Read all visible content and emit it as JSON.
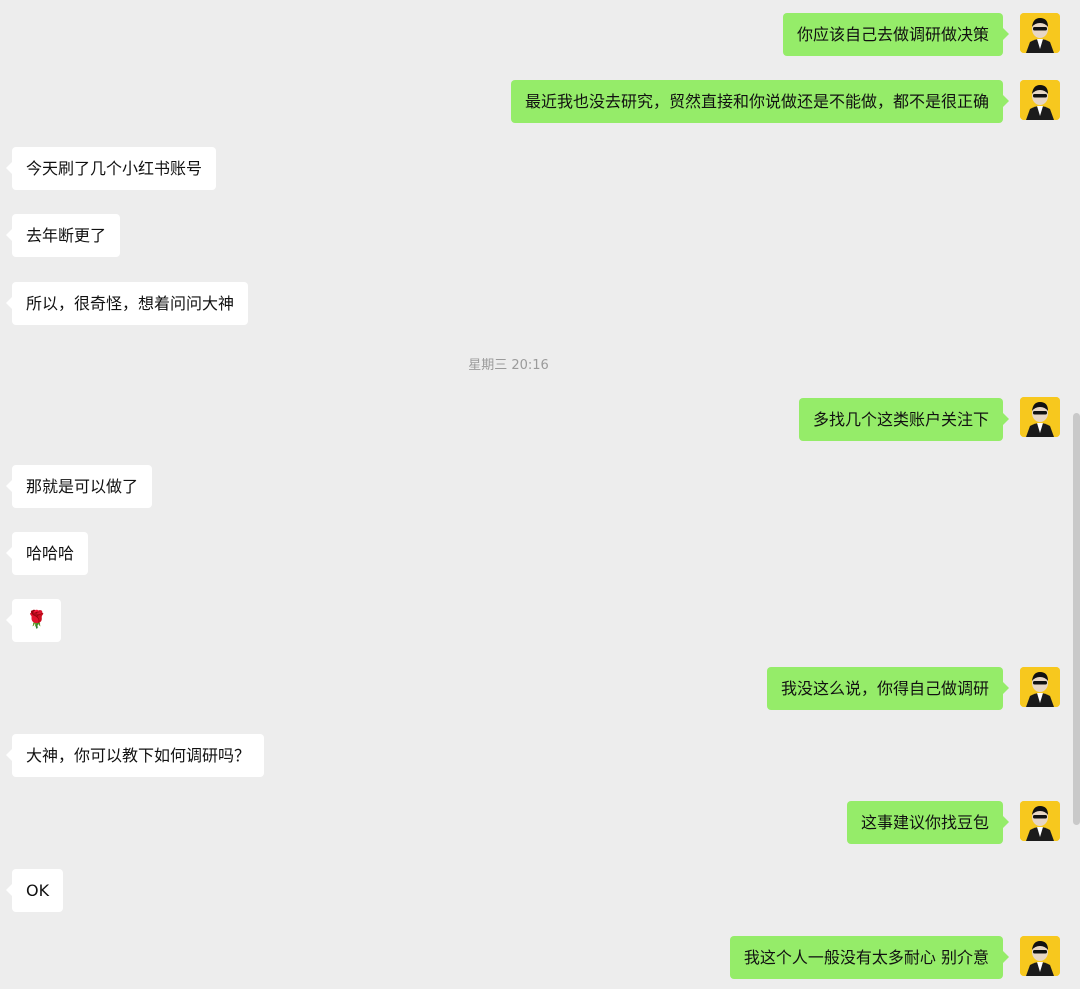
{
  "messages": [
    {
      "side": "right",
      "text": "你应该自己去做调研做决策"
    },
    {
      "side": "right",
      "text": "最近我也没去研究，贸然直接和你说做还是不能做，都不是很正确"
    },
    {
      "side": "left",
      "text": "今天刷了几个小红书账号"
    },
    {
      "side": "left",
      "text": "去年断更了"
    },
    {
      "side": "left",
      "text": "所以，很奇怪，想着问问大神"
    },
    {
      "type": "time",
      "text": "星期三 20:16"
    },
    {
      "side": "right",
      "text": "多找几个这类账户关注下"
    },
    {
      "side": "left",
      "text": "那就是可以做了"
    },
    {
      "side": "left",
      "text": "哈哈哈"
    },
    {
      "side": "left",
      "text": "🌹"
    },
    {
      "side": "right",
      "text": "我没这么说，你得自己做调研"
    },
    {
      "side": "left",
      "text": "大神，你可以教下如何调研吗？"
    },
    {
      "side": "right",
      "text": "这事建议你找豆包"
    },
    {
      "side": "left",
      "text": "OK"
    },
    {
      "side": "right",
      "text": "我这个人一般没有太多耐心 别介意"
    }
  ],
  "colors": {
    "background": "#ededed",
    "sent_bubble": "#95ec69",
    "received_bubble": "#ffffff",
    "avatar_bg": "#f7c81e"
  },
  "icons": {
    "self_avatar": "man-in-suit-avatar-icon"
  }
}
